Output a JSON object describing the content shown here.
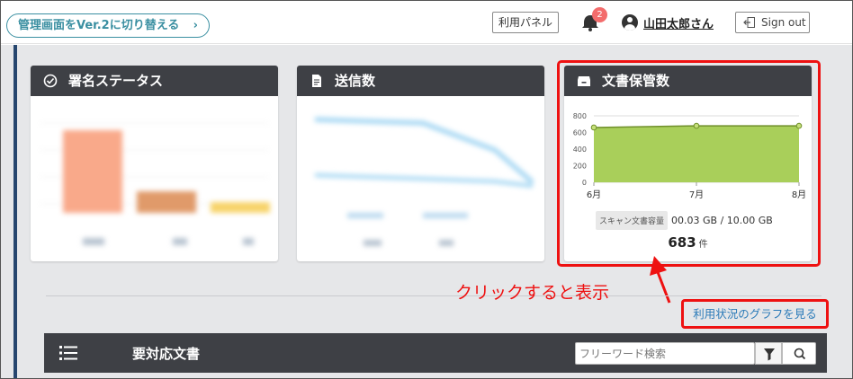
{
  "header": {
    "switch_version": "管理画面をVer.2に切り替える",
    "usage_panel": "利用パネル",
    "notification_count": "2",
    "user_name": "山田太郎さん",
    "sign_out": "Sign out"
  },
  "cards": {
    "signature_status": {
      "title": "署名ステータス"
    },
    "sent_count": {
      "title": "送信数"
    },
    "document_storage": {
      "title": "文書保管数",
      "storage_label": "スキャン文書容量",
      "storage_value": "00.03 GB / 10.00 GB",
      "count": "683",
      "count_unit": "件"
    }
  },
  "chart_data": {
    "type": "area",
    "x": [
      "6月",
      "7月",
      "8月"
    ],
    "series": [
      {
        "values": [
          660,
          680,
          680
        ]
      }
    ],
    "y_ticks": [
      "800",
      "600",
      "400",
      "200",
      "0"
    ],
    "ylim": [
      0,
      800
    ],
    "fill_color": "#a9cf5a",
    "line_color": "#6f8f2a"
  },
  "annotation": {
    "text": "クリックすると表示",
    "color": "#ee1111"
  },
  "graph_link": "利用状況のグラフを見る",
  "todo": {
    "title": "要対応文書",
    "search_placeholder": "フリーワード検索"
  },
  "colors": {
    "accent": "#3a8fa1",
    "card_header": "#3e4045",
    "highlight": "#ee1111"
  }
}
